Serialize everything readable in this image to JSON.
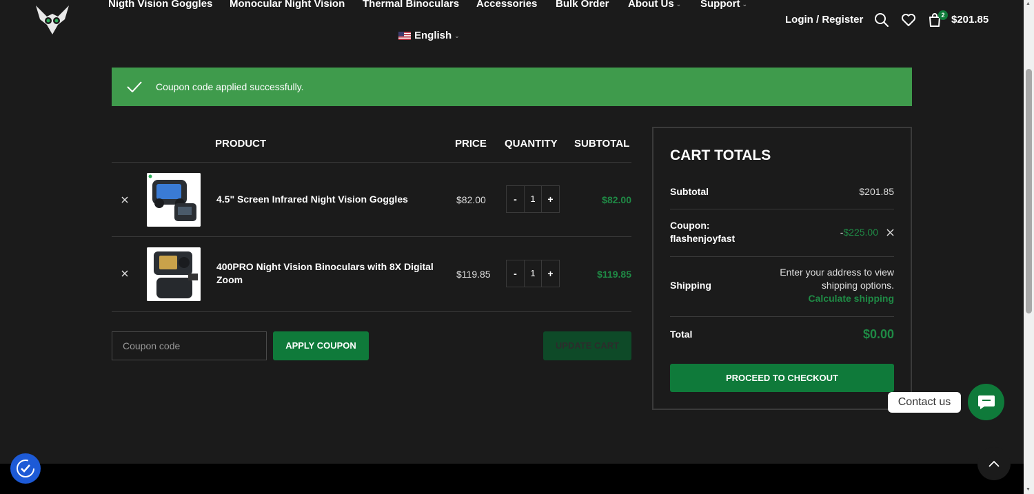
{
  "header": {
    "nav": [
      {
        "label": "Nigth Vision Goggles",
        "dropdown": false
      },
      {
        "label": "Monocular Night Vision",
        "dropdown": false
      },
      {
        "label": "Thermal Binoculars",
        "dropdown": false
      },
      {
        "label": "Accessories",
        "dropdown": false
      },
      {
        "label": "Bulk Order",
        "dropdown": false
      },
      {
        "label": "About Us",
        "dropdown": true
      },
      {
        "label": "Support",
        "dropdown": true
      }
    ],
    "language": "English",
    "login_label": "Login / Register",
    "cart_count": "2",
    "cart_total": "$201.85"
  },
  "notice": {
    "message": "Coupon code applied successfully."
  },
  "cart_table": {
    "headers": {
      "product": "Product",
      "price": "Price",
      "quantity": "Quantity",
      "subtotal": "Subtotal"
    },
    "items": [
      {
        "name": "4.5\" Screen Infrared Night Vision Goggles",
        "price": "$82.00",
        "quantity": "1",
        "subtotal": "$82.00"
      },
      {
        "name": "400PRO Night Vision Binoculars with 8X Digital Zoom",
        "price": "$119.85",
        "quantity": "1",
        "subtotal": "$119.85"
      }
    ],
    "minus": "-",
    "plus": "+",
    "coupon_placeholder": "Coupon code",
    "apply_label": "Apply Coupon",
    "update_label": "Update Cart"
  },
  "totals": {
    "title": "Cart Totals",
    "subtotal_label": "Subtotal",
    "subtotal_value": "$201.85",
    "coupon_label": "Coupon:",
    "coupon_code": "flashenjoyfast",
    "coupon_sign": "-",
    "coupon_value": "$225.00",
    "shipping_label": "Shipping",
    "shipping_note_1": "Enter your address to view",
    "shipping_note_2": "shipping options.",
    "calc_shipping": "Calculate shipping",
    "total_label": "Total",
    "total_value": "$0.00",
    "checkout_label": "Proceed to Checkout"
  },
  "floating": {
    "contact_label": "Contact us"
  },
  "colors": {
    "background": "#1b1b1b",
    "accent_green": "#0f7a3a",
    "price_green": "#1f8a45",
    "notice_green": "#3f9b4c"
  }
}
